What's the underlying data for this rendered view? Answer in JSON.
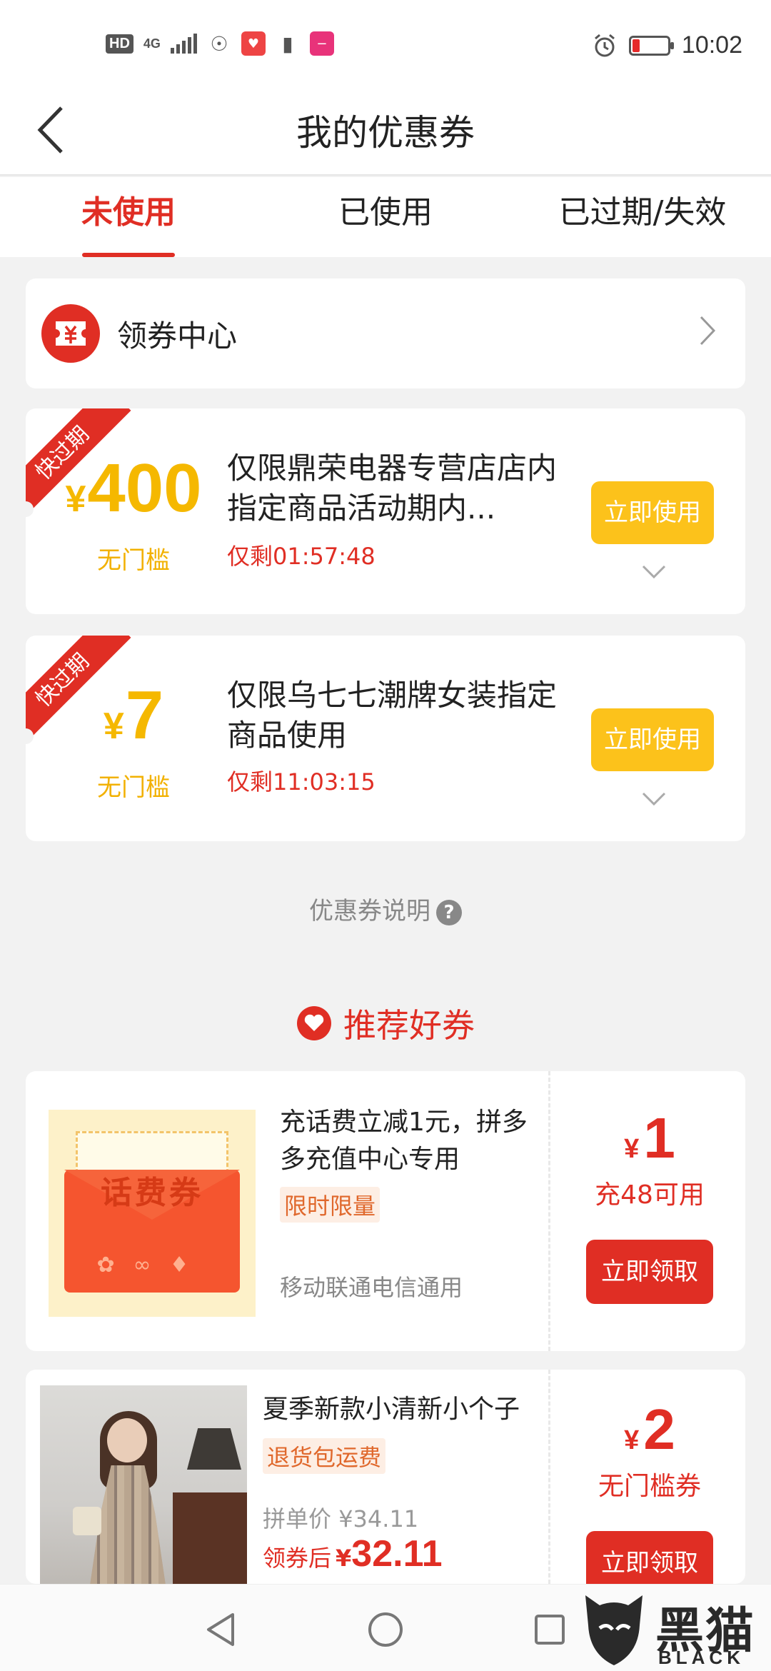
{
  "status_bar": {
    "hd": "HD",
    "network": "4G",
    "time": "10:02"
  },
  "header": {
    "title": "我的优惠券"
  },
  "tabs": [
    {
      "label": "未使用",
      "active": true
    },
    {
      "label": "已使用",
      "active": false
    },
    {
      "label": "已过期/失效",
      "active": false
    }
  ],
  "coupon_center": {
    "label": "领券中心",
    "icon": "coupon-ticket-icon"
  },
  "coupons": [
    {
      "badge": "快过期",
      "currency": "¥",
      "amount": "400",
      "threshold": "无门槛",
      "description": "仅限鼎荣电器专营店店内指定商品活动期内...",
      "timer": "仅剩01:57:48",
      "button": "立即使用"
    },
    {
      "badge": "快过期",
      "currency": "¥",
      "amount": "7",
      "threshold": "无门槛",
      "description": "仅限乌七七潮牌女装指定商品使用",
      "timer": "仅剩11:03:15",
      "button": "立即使用"
    }
  ],
  "explanation": {
    "label": "优惠券说明",
    "icon": "?"
  },
  "recommend": {
    "title": "推荐好券",
    "items": [
      {
        "image_text": "话费券",
        "title": "充话费立减1元，拼多多充值中心专用",
        "tag": "限时限量",
        "subtitle": "移动联通电信通用",
        "currency": "¥",
        "amount": "1",
        "condition": "充48可用",
        "button": "立即领取"
      },
      {
        "title": "夏季新款小清新小个子",
        "tag": "退货包运费",
        "price_label": "拼单价",
        "price": "¥34.11",
        "after_label": "领券后",
        "after_currency": "¥",
        "after_price": "32.11",
        "currency": "¥",
        "amount": "2",
        "condition": "无门槛券",
        "button": "立即领取"
      }
    ]
  },
  "watermark": {
    "text": "黑猫",
    "sub": "BLACK CAT"
  },
  "colors": {
    "accent": "#e02e24",
    "coupon_yellow": "#fcc21b",
    "amount_gold": "#f5b800"
  }
}
